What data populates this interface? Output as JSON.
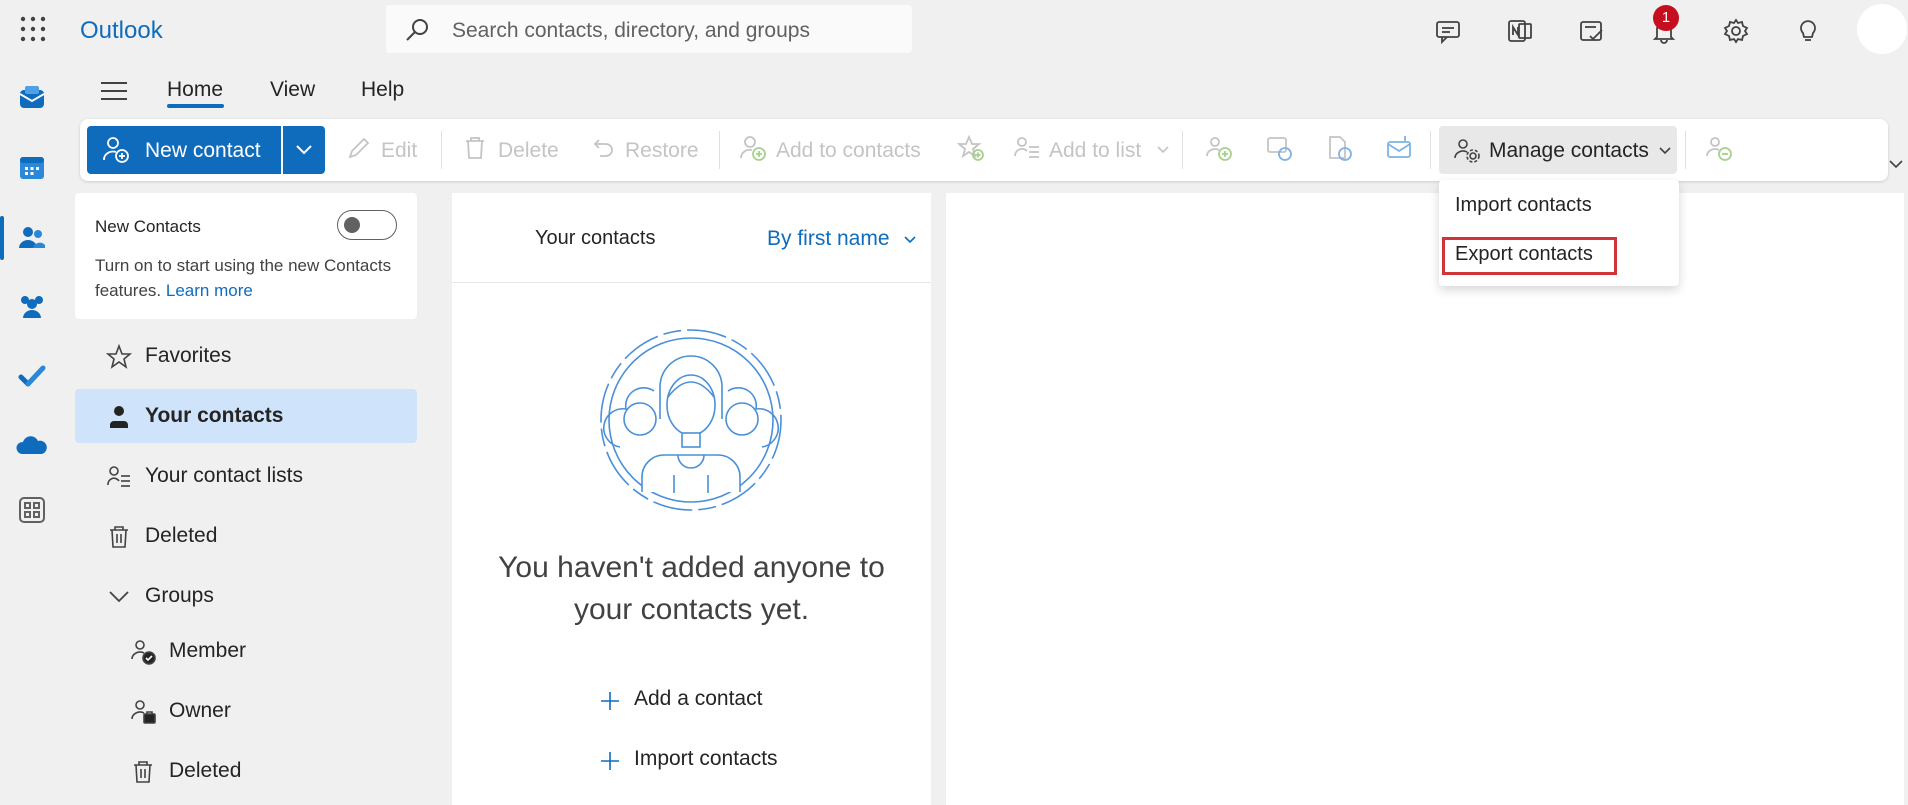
{
  "app": {
    "name": "Outlook"
  },
  "search": {
    "placeholder": "Search contacts, directory, and groups"
  },
  "header": {
    "notification_count": "1"
  },
  "ribbon": {
    "tabs": [
      {
        "label": "Home",
        "selected": true
      },
      {
        "label": "View",
        "selected": false
      },
      {
        "label": "Help",
        "selected": false
      }
    ]
  },
  "toolbar": {
    "new_contact": "New contact",
    "edit": "Edit",
    "delete": "Delete",
    "restore": "Restore",
    "add_to_contacts": "Add to contacts",
    "add_to_list": "Add to list",
    "manage_contacts": "Manage contacts"
  },
  "manage_menu": {
    "items": [
      {
        "label": "Import contacts",
        "highlighted": false
      },
      {
        "label": "Export contacts",
        "highlighted": true
      }
    ],
    "highlight_color": "#d13438"
  },
  "new_contacts_card": {
    "title": "New Contacts",
    "description": "Turn on to start using the new Contacts features.",
    "link": "Learn more",
    "toggle_on": false
  },
  "nav": {
    "favorites": "Favorites",
    "your_contacts": "Your contacts",
    "your_contact_lists": "Your contact lists",
    "deleted": "Deleted",
    "groups": "Groups",
    "group_member": "Member",
    "group_owner": "Owner",
    "group_deleted": "Deleted"
  },
  "list": {
    "title": "Your contacts",
    "sort": "By first name",
    "empty_line1": "You haven't added anyone to",
    "empty_line2": "your contacts yet.",
    "add_contact": "Add a contact",
    "import_contacts": "Import contacts"
  },
  "colors": {
    "accent": "#0f6cbd",
    "selected_bg": "#cfe4fa",
    "badge": "#c50f1f"
  }
}
